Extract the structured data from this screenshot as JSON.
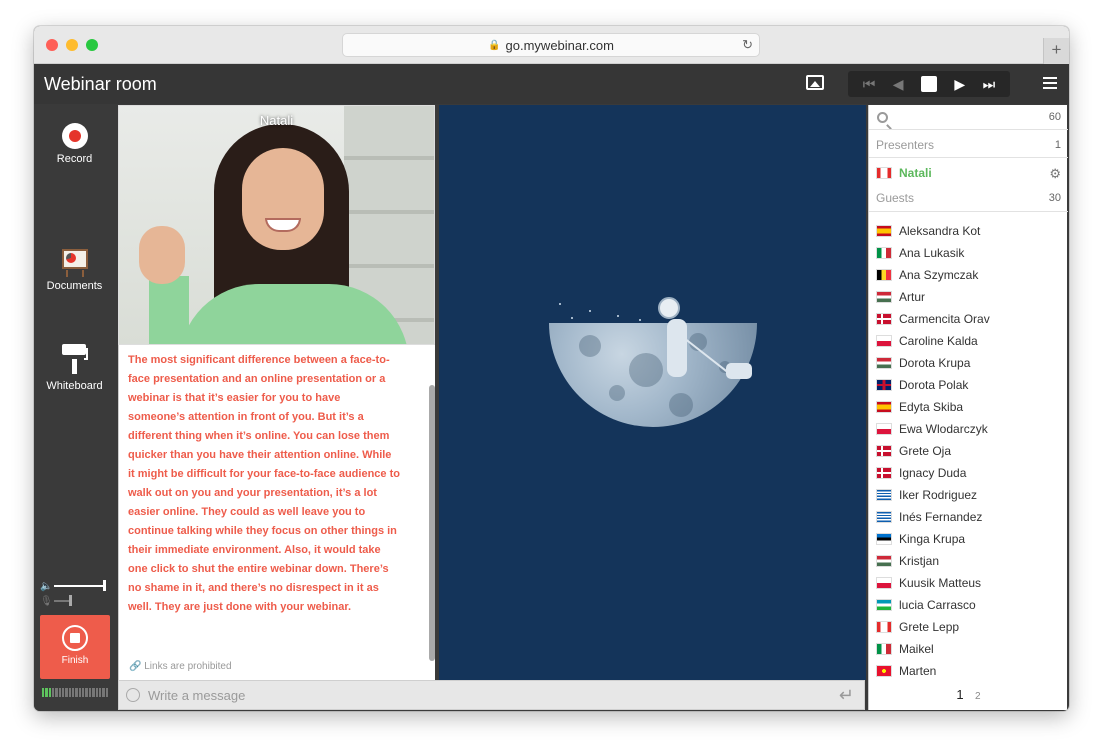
{
  "browser": {
    "url": "go.mywebinar.com"
  },
  "app": {
    "title": "Webinar room"
  },
  "toolbar": {
    "record_label": "Record",
    "documents_label": "Documents",
    "whiteboard_label": "Whiteboard",
    "finish_label": "Finish",
    "speaker_volume": 1.0,
    "mic_volume": 0.35
  },
  "video": {
    "presenter_name": "Natali"
  },
  "chat": {
    "message": "The most significant difference between a face-to-face presentation and an online presentation or a webinar is that it’s easier for you to have someone’s attention in front of you. But it’s a different thing when it’s online. You can lose them quicker than you have their attention online. While it might be difficult for your face-to-face audience to walk out on you and your presentation, it’s a lot easier online. They could as well leave you to continue talking while they focus on other things in their immediate environment. Also, it would take one click to shut the entire webinar down. There’s no shame in it, and there’s no disrespect in it as well. They are just done with your webinar.",
    "links_note": "Links are prohibited",
    "input_placeholder": "Write a message"
  },
  "participants": {
    "total": "60",
    "presenters_label": "Presenters",
    "presenters_count": "1",
    "presenter": {
      "name": "Natali",
      "flag": "ca"
    },
    "guests_label": "Guests",
    "guests_count": "30",
    "guests": [
      {
        "name": "Aleksandra Kot",
        "flag": "es"
      },
      {
        "name": "Ana Lukasik",
        "flag": "it"
      },
      {
        "name": "Ana Szymczak",
        "flag": "be"
      },
      {
        "name": "Artur",
        "flag": "hu"
      },
      {
        "name": "Carmencita Orav",
        "flag": "dk"
      },
      {
        "name": "Caroline Kalda",
        "flag": "pl"
      },
      {
        "name": "Dorota Krupa",
        "flag": "hu"
      },
      {
        "name": "Dorota Polak",
        "flag": "gb"
      },
      {
        "name": "Edyta Skiba",
        "flag": "es"
      },
      {
        "name": "Ewa Wlodarczyk",
        "flag": "pl"
      },
      {
        "name": "Grete Oja",
        "flag": "dk"
      },
      {
        "name": "Ignacy Duda",
        "flag": "dk"
      },
      {
        "name": "Iker Rodriguez",
        "flag": "gr"
      },
      {
        "name": "Inés Fernandez",
        "flag": "gr"
      },
      {
        "name": "Kinga Krupa",
        "flag": "ee"
      },
      {
        "name": "Kristjan",
        "flag": "hu"
      },
      {
        "name": "Kuusik Matteus",
        "flag": "pl"
      },
      {
        "name": "lucia Carrasco",
        "flag": "uz"
      },
      {
        "name": "Grete Lepp",
        "flag": "ca"
      },
      {
        "name": "Maikel",
        "flag": "it"
      },
      {
        "name": "Marten",
        "flag": "kg"
      }
    ],
    "pages": [
      "1",
      "2"
    ]
  },
  "colors": {
    "accent_red": "#ee5c4b",
    "presenter_green": "#5cb85c",
    "slide_bg": "#14345a"
  }
}
